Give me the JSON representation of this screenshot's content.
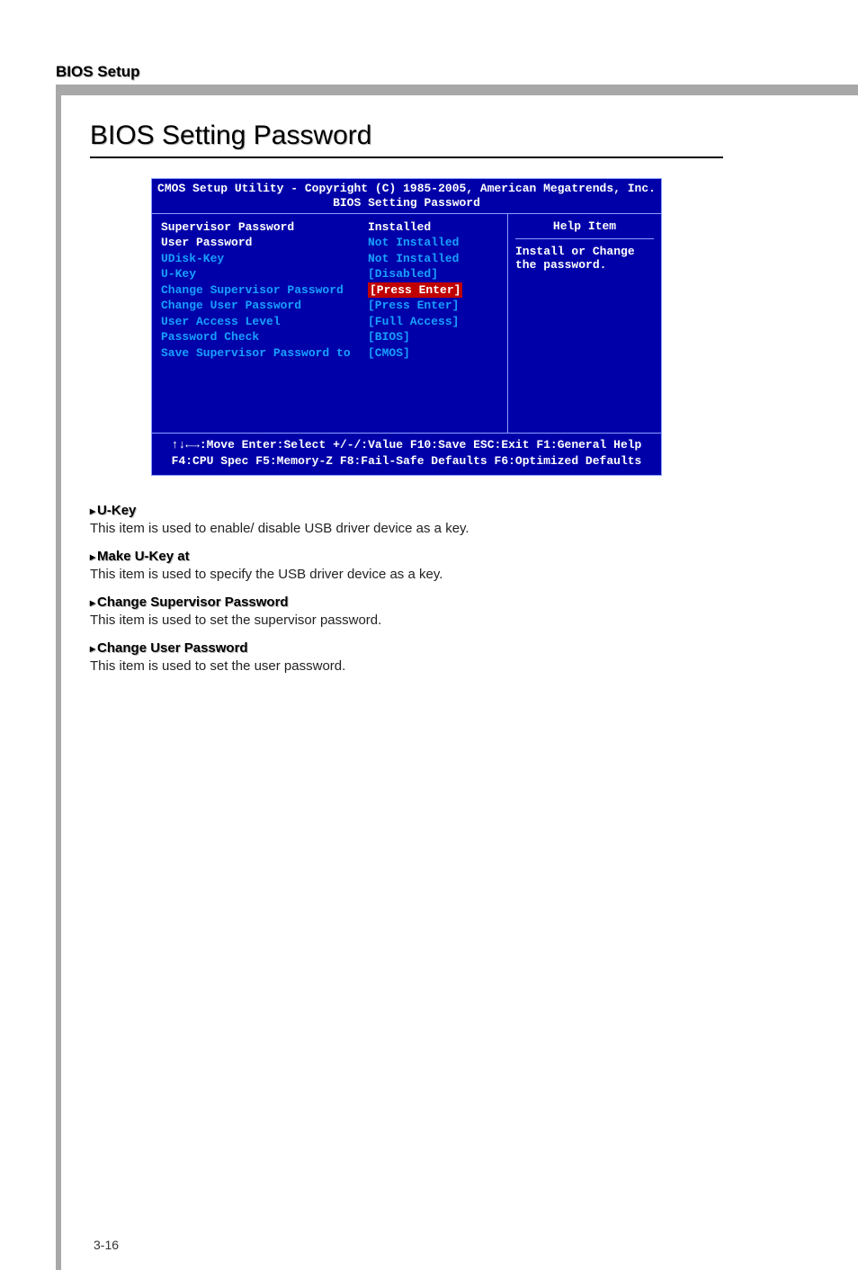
{
  "header": {
    "title": "BIOS Setup"
  },
  "section": {
    "title": "BIOS Setting Password"
  },
  "bios": {
    "title_line1": "CMOS Setup Utility - Copyright (C) 1985-2005, American Megatrends, Inc.",
    "title_line2": "BIOS Setting Password",
    "rows": [
      {
        "label": "Supervisor Password",
        "value": "Installed",
        "label_white": true,
        "value_white": true
      },
      {
        "label": "User Password",
        "value": "Not Installed",
        "label_white": true
      },
      {
        "label": "UDisk-Key",
        "value": "Not Installed"
      },
      {
        "label": "",
        "value": ""
      },
      {
        "label": "U-Key",
        "value": "[Disabled]"
      },
      {
        "label": "",
        "value": ""
      },
      {
        "label": "Change Supervisor Password",
        "value": "[Press Enter]",
        "selected": true
      },
      {
        "label": "Change User Password",
        "value": "[Press Enter]"
      },
      {
        "label": "User Access Level",
        "value": "[Full Access]"
      },
      {
        "label": "",
        "value": ""
      },
      {
        "label": "Password Check",
        "value": "[BIOS]"
      },
      {
        "label": "Save Supervisor Password to",
        "value": "[CMOS]"
      }
    ],
    "help_title": "Help Item",
    "help_text": "Install or Change the password.",
    "footer_line1": "↑↓←→:Move  Enter:Select  +/-/:Value  F10:Save  ESC:Exit  F1:General Help",
    "footer_line2": "F4:CPU Spec  F5:Memory-Z  F8:Fail-Safe Defaults    F6:Optimized Defaults"
  },
  "descriptions": [
    {
      "head": "U-Key",
      "text": "This item is used to enable/ disable USB driver device as a key."
    },
    {
      "head": "Make U-Key at",
      "text": "This item is used to specify the USB driver device as a key."
    },
    {
      "head": "Change Supervisor Password",
      "text": "This item is used to set the supervisor password."
    },
    {
      "head": "Change User Password",
      "text": "This item is used to set the user password."
    }
  ],
  "page_number": "3-16"
}
